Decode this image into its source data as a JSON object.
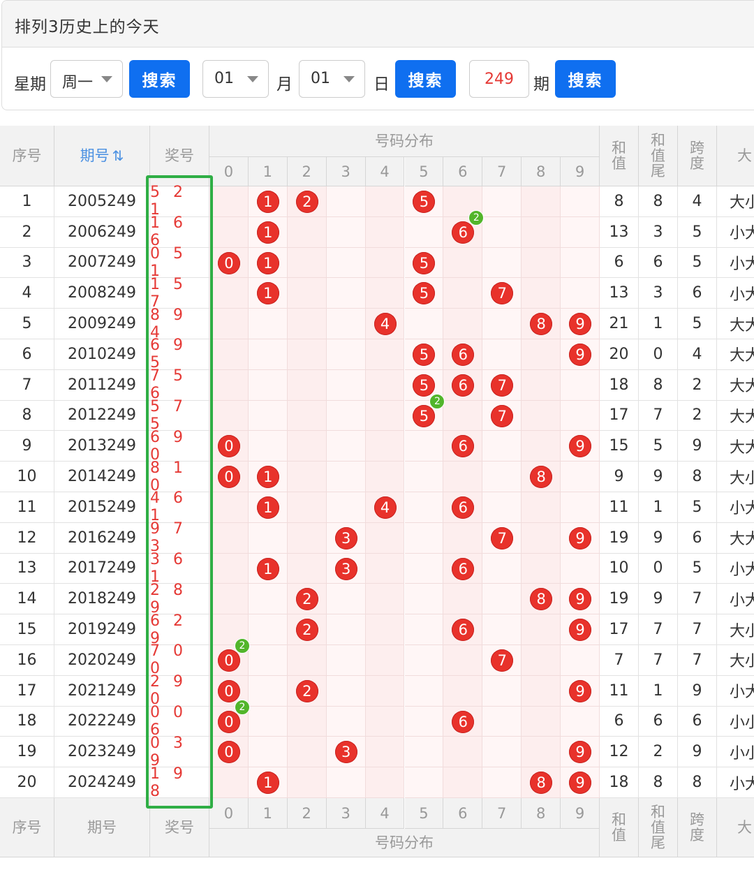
{
  "header": {
    "title": "排列3历史上的今天"
  },
  "search": {
    "weekday_label": "星期",
    "weekday_value": "周一",
    "search_btn": "搜索",
    "month_value": "01",
    "month_label": "月",
    "day_value": "01",
    "day_label": "日",
    "issue_value": "249",
    "issue_label": "期"
  },
  "table": {
    "headers": {
      "index": "序号",
      "issue": "期号",
      "sort_icon": "sort-icon",
      "prize": "奖号",
      "distribution": "号码分布",
      "sum": "和值",
      "sum_tail": "和值尾",
      "span": "跨度",
      "size": "大"
    },
    "digits": [
      "0",
      "1",
      "2",
      "3",
      "4",
      "5",
      "6",
      "7",
      "8",
      "9"
    ],
    "rows": [
      {
        "idx": "1",
        "issue": "2005249",
        "prize": "521",
        "sum": "8",
        "tail": "8",
        "span": "4",
        "size": "大小"
      },
      {
        "idx": "2",
        "issue": "2006249",
        "prize": "166",
        "sum": "13",
        "tail": "3",
        "span": "5",
        "size": "小大"
      },
      {
        "idx": "3",
        "issue": "2007249",
        "prize": "051",
        "sum": "6",
        "tail": "6",
        "span": "5",
        "size": "小大"
      },
      {
        "idx": "4",
        "issue": "2008249",
        "prize": "157",
        "sum": "13",
        "tail": "3",
        "span": "6",
        "size": "小大"
      },
      {
        "idx": "5",
        "issue": "2009249",
        "prize": "894",
        "sum": "21",
        "tail": "1",
        "span": "5",
        "size": "大大"
      },
      {
        "idx": "6",
        "issue": "2010249",
        "prize": "695",
        "sum": "20",
        "tail": "0",
        "span": "4",
        "size": "大大"
      },
      {
        "idx": "7",
        "issue": "2011249",
        "prize": "756",
        "sum": "18",
        "tail": "8",
        "span": "2",
        "size": "大大"
      },
      {
        "idx": "8",
        "issue": "2012249",
        "prize": "575",
        "sum": "17",
        "tail": "7",
        "span": "2",
        "size": "大大"
      },
      {
        "idx": "9",
        "issue": "2013249",
        "prize": "690",
        "sum": "15",
        "tail": "5",
        "span": "9",
        "size": "大大"
      },
      {
        "idx": "10",
        "issue": "2014249",
        "prize": "810",
        "sum": "9",
        "tail": "9",
        "span": "8",
        "size": "大小"
      },
      {
        "idx": "11",
        "issue": "2015249",
        "prize": "461",
        "sum": "11",
        "tail": "1",
        "span": "5",
        "size": "小大"
      },
      {
        "idx": "12",
        "issue": "2016249",
        "prize": "973",
        "sum": "19",
        "tail": "9",
        "span": "6",
        "size": "大大"
      },
      {
        "idx": "13",
        "issue": "2017249",
        "prize": "361",
        "sum": "10",
        "tail": "0",
        "span": "5",
        "size": "小大"
      },
      {
        "idx": "14",
        "issue": "2018249",
        "prize": "289",
        "sum": "19",
        "tail": "9",
        "span": "7",
        "size": "小大"
      },
      {
        "idx": "15",
        "issue": "2019249",
        "prize": "629",
        "sum": "17",
        "tail": "7",
        "span": "7",
        "size": "大小"
      },
      {
        "idx": "16",
        "issue": "2020249",
        "prize": "700",
        "sum": "7",
        "tail": "7",
        "span": "7",
        "size": "大小"
      },
      {
        "idx": "17",
        "issue": "2021249",
        "prize": "290",
        "sum": "11",
        "tail": "1",
        "span": "9",
        "size": "小大"
      },
      {
        "idx": "18",
        "issue": "2022249",
        "prize": "006",
        "sum": "6",
        "tail": "6",
        "span": "6",
        "size": "小小"
      },
      {
        "idx": "19",
        "issue": "2023249",
        "prize": "039",
        "sum": "12",
        "tail": "2",
        "span": "9",
        "size": "小小"
      },
      {
        "idx": "20",
        "issue": "2024249",
        "prize": "198",
        "sum": "18",
        "tail": "8",
        "span": "8",
        "size": "小大"
      }
    ],
    "repeat_badge": "2"
  },
  "colors": {
    "ball": "#e8322b",
    "badge": "#52b52b",
    "button": "#0f6ff0",
    "highlight_box": "#2fae45",
    "dist_alt": "#fdeeee"
  }
}
